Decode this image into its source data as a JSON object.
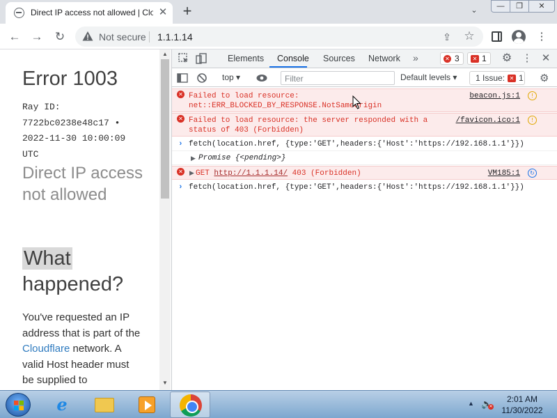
{
  "browser": {
    "tab_title": "Direct IP access not allowed | Clo",
    "tab_close": "✕",
    "new_tab": "+",
    "tab_search": "⌄",
    "window_buttons": {
      "minimize": "—",
      "maximize": "❐",
      "close": "✕"
    },
    "nav": {
      "back": "←",
      "forward": "→",
      "reload": "↻"
    },
    "security_label": "Not secure",
    "url": "1.1.1.14",
    "share": "⇪",
    "star": "☆",
    "menu": "⋮"
  },
  "page": {
    "error_title": "Error 1003",
    "ray_lines": [
      "Ray ID:",
      "7722bc0238e48c17 •",
      "2022-11-30 10:00:09",
      "UTC"
    ],
    "subtitle": "Direct IP access not allowed",
    "what_line1": "What",
    "what_line2": "happened?",
    "desc_before": "You've requested an IP address that is part of the ",
    "desc_link": "Cloudflare",
    "desc_after": " network. A valid Host header must be supplied to",
    "link_color": "#2f7bbf"
  },
  "devtools": {
    "tabs": [
      "Elements",
      "Console",
      "Sources",
      "Network"
    ],
    "active_tab": "Console",
    "more_tabs": "»",
    "error_badge": "3",
    "issue_badge": "1",
    "console_bar": {
      "context": "top ▾",
      "filter_placeholder": "Filter",
      "levels": "Default levels ▾",
      "issues_label": "1 Issue:",
      "issues_count": "1"
    },
    "rows": [
      {
        "type": "error",
        "text1": "Failed to load resource:",
        "text2": "net::ERR_BLOCKED_BY_RESPONSE.NotSameOrigin",
        "source": "beacon.js:1"
      },
      {
        "type": "error",
        "text1": "Failed to load resource: the server responded with a",
        "text2": "status of 403 (Forbidden)",
        "source": "/favicon.ico:1"
      },
      {
        "type": "input",
        "text1": "fetch(location.href, {type:'GET',headers:{'Host':'https://192.168.1.1'}})"
      },
      {
        "type": "output",
        "text1": "Promise {<pending>}"
      },
      {
        "type": "error",
        "method": "GET",
        "url": "http://1.1.1.14/",
        "status": "403 (Forbidden)",
        "source": "VM185:1"
      },
      {
        "type": "input",
        "text1": "fetch(location.href, {type:'GET',headers:{'Host':'https://192.168.1.1'}})"
      }
    ],
    "error_color": "#d93025",
    "accent_color": "#1a73e8"
  },
  "taskbar": {
    "time": "2:01 AM",
    "date": "11/30/2022",
    "apps": [
      "internet-explorer",
      "file-explorer",
      "media-player",
      "google-chrome"
    ],
    "active_app": "google-chrome"
  }
}
